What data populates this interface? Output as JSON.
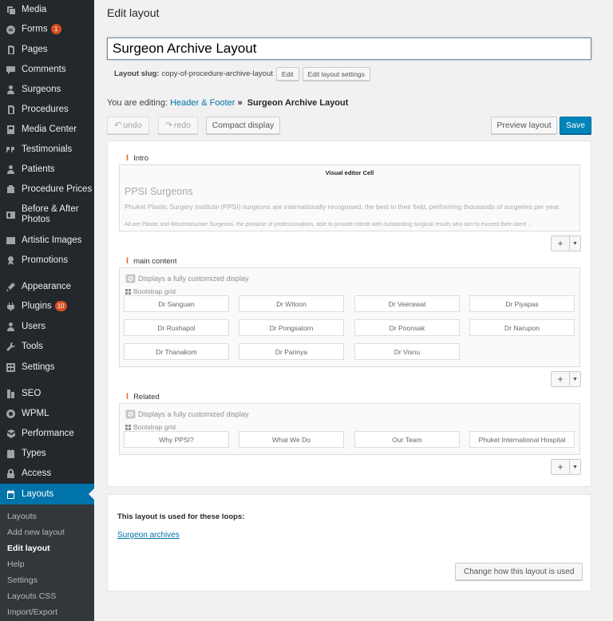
{
  "sidebar": {
    "items": [
      {
        "label": "Media",
        "icon": "media-icon",
        "badge": ""
      },
      {
        "label": "Forms",
        "icon": "forms-icon",
        "badge": "1"
      },
      {
        "label": "Pages",
        "icon": "pages-icon",
        "badge": ""
      },
      {
        "label": "Comments",
        "icon": "comments-icon",
        "badge": ""
      },
      {
        "label": "Surgeons",
        "icon": "surgeons-icon",
        "badge": ""
      },
      {
        "label": "Procedures",
        "icon": "procedures-icon",
        "badge": ""
      },
      {
        "label": "Media Center",
        "icon": "media-center-icon",
        "badge": ""
      },
      {
        "label": "Testimonials",
        "icon": "testimonials-icon",
        "badge": ""
      },
      {
        "label": "Patients",
        "icon": "patients-icon",
        "badge": ""
      },
      {
        "label": "Procedure Prices",
        "icon": "procedure-prices-icon",
        "badge": ""
      },
      {
        "label": "Before & After Photos",
        "icon": "before-after-icon",
        "badge": ""
      },
      {
        "label": "Artistic Images",
        "icon": "artistic-images-icon",
        "badge": ""
      },
      {
        "label": "Promotions",
        "icon": "promotions-icon",
        "badge": ""
      },
      {
        "label": "Appearance",
        "icon": "appearance-icon",
        "badge": ""
      },
      {
        "label": "Plugins",
        "icon": "plugins-icon",
        "badge": "10"
      },
      {
        "label": "Users",
        "icon": "users-icon",
        "badge": ""
      },
      {
        "label": "Tools",
        "icon": "tools-icon",
        "badge": ""
      },
      {
        "label": "Settings",
        "icon": "settings-icon",
        "badge": ""
      },
      {
        "label": "SEO",
        "icon": "seo-icon",
        "badge": ""
      },
      {
        "label": "WPML",
        "icon": "wpml-icon",
        "badge": ""
      },
      {
        "label": "Performance",
        "icon": "performance-icon",
        "badge": ""
      },
      {
        "label": "Types",
        "icon": "types-icon",
        "badge": ""
      },
      {
        "label": "Access",
        "icon": "access-icon",
        "badge": ""
      },
      {
        "label": "Layouts",
        "icon": "layouts-icon",
        "badge": ""
      }
    ],
    "submenu": [
      "Layouts",
      "Add new layout",
      "Edit layout",
      "Help",
      "Settings",
      "Layouts CSS",
      "Import/Export"
    ]
  },
  "header": {
    "title": "Edit layout",
    "layout_name": "Surgeon Archive Layout",
    "slug_label": "Layout slug:",
    "slug_value": "copy-of-procedure-archive-layout",
    "edit_label": "Edit",
    "edit_settings_label": "Edit layout settings",
    "editing_prefix": "You are editing:",
    "editing_parent": "Header & Footer",
    "editing_sep": "»",
    "editing_current": "Surgeon Archive Layout"
  },
  "toolbar": {
    "undo": "undo",
    "redo": "redo",
    "compact": "Compact display",
    "preview": "Preview layout",
    "save": "Save"
  },
  "rows": {
    "intro": {
      "label": "Intro",
      "cell_title": "Visual editor Cell",
      "heading": "PPSI Surgeons",
      "text": "Phuket Plastic Surgery Institute (PPSI) surgeons are internationally recognised, the best in their field, performing thousands of surgeries per year.",
      "text2": "All are Plastic and Reconstructive Surgeons, the pinnacle of professionalism, able to provide clients with outstanding surgical results who aim to exceed their client ..."
    },
    "main": {
      "label": "main content",
      "display": "Displays a fully customized display",
      "grid": "Bootstrap grid",
      "cells": [
        "Dr Sanguan",
        "Dr Witoon",
        "Dr Veerawat",
        "Dr Piyapas",
        "Dr Rushapol",
        "Dr Pongsatorn",
        "Dr Poonsak",
        "Dr Narupon",
        "Dr Thanakom",
        "Dr Parinya",
        "Dr Visnu"
      ]
    },
    "related": {
      "label": "Related",
      "display": "Displays a fully customized display",
      "grid": "Bootstrap grid",
      "cells": [
        "Why PPSI?",
        "What We Do",
        "Our Team",
        "Phuket International Hospital"
      ]
    },
    "add_symbol": "+"
  },
  "loops": {
    "heading": "This layout is used for these loops:",
    "link": "Surgeon archives",
    "change_button": "Change how this layout is used"
  },
  "colors": {
    "accent": "#0073aa",
    "sidebar": "#23282d",
    "badge": "#d54e21"
  }
}
